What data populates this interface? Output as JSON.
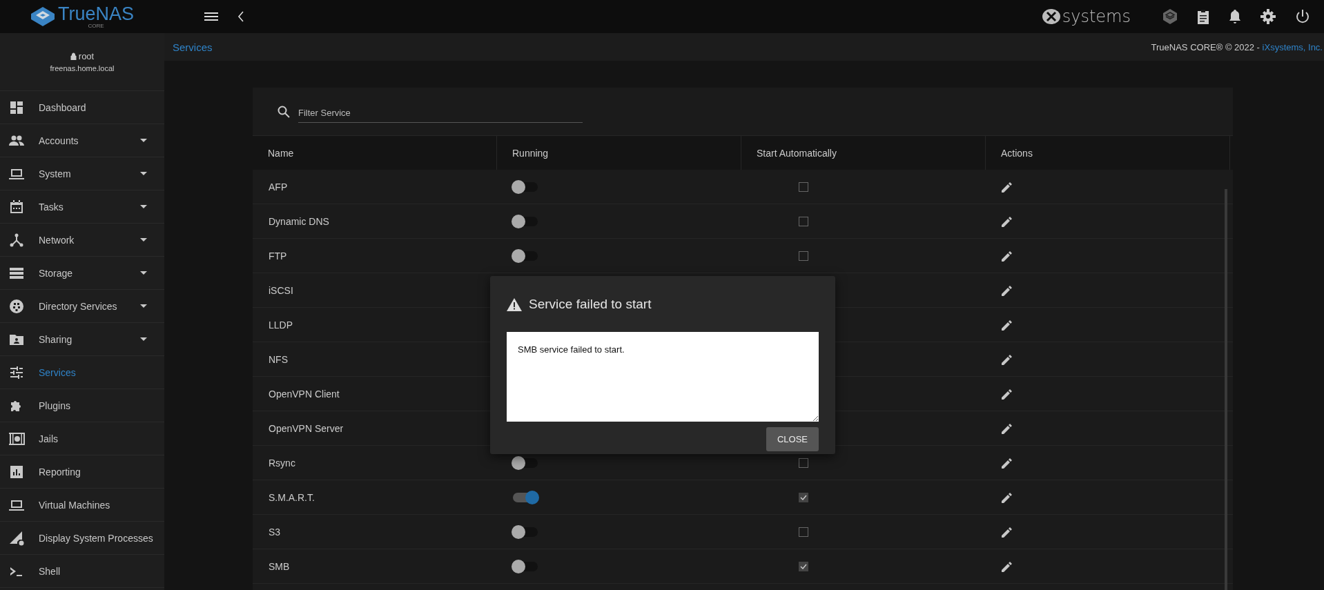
{
  "header": {
    "logo_text": "TrueNAS",
    "logo_subtext": "CORE",
    "vendor_logo_text": "systems"
  },
  "user": {
    "name": "root",
    "host": "freenas.home.local"
  },
  "sidebar": {
    "items": [
      {
        "label": "Dashboard",
        "expandable": false,
        "selected": false
      },
      {
        "label": "Accounts",
        "expandable": true,
        "selected": false
      },
      {
        "label": "System",
        "expandable": true,
        "selected": false
      },
      {
        "label": "Tasks",
        "expandable": true,
        "selected": false
      },
      {
        "label": "Network",
        "expandable": true,
        "selected": false
      },
      {
        "label": "Storage",
        "expandable": true,
        "selected": false
      },
      {
        "label": "Directory Services",
        "expandable": true,
        "selected": false
      },
      {
        "label": "Sharing",
        "expandable": true,
        "selected": false
      },
      {
        "label": "Services",
        "expandable": false,
        "selected": true
      },
      {
        "label": "Plugins",
        "expandable": false,
        "selected": false
      },
      {
        "label": "Jails",
        "expandable": false,
        "selected": false
      },
      {
        "label": "Reporting",
        "expandable": false,
        "selected": false
      },
      {
        "label": "Virtual Machines",
        "expandable": false,
        "selected": false
      },
      {
        "label": "Display System Processes",
        "expandable": false,
        "selected": false
      },
      {
        "label": "Shell",
        "expandable": false,
        "selected": false
      }
    ]
  },
  "breadcrumb": "Services",
  "copyright": {
    "text": "TrueNAS CORE® © 2022 - ",
    "link": "iXsystems, Inc."
  },
  "search": {
    "placeholder": "Filter Service"
  },
  "table": {
    "columns": [
      "Name",
      "Running",
      "Start Automatically",
      "Actions"
    ],
    "rows": [
      {
        "name": "AFP",
        "running": false,
        "start_automatically": false
      },
      {
        "name": "Dynamic DNS",
        "running": false,
        "start_automatically": false
      },
      {
        "name": "FTP",
        "running": false,
        "start_automatically": false
      },
      {
        "name": "iSCSI"
      },
      {
        "name": "LLDP"
      },
      {
        "name": "NFS"
      },
      {
        "name": "OpenVPN Client"
      },
      {
        "name": "OpenVPN Server"
      },
      {
        "name": "Rsync",
        "running": false,
        "start_automatically": false
      },
      {
        "name": "S.M.A.R.T.",
        "running": true,
        "start_automatically": true
      },
      {
        "name": "S3",
        "running": false,
        "start_automatically": false
      },
      {
        "name": "SMB",
        "running": false,
        "start_automatically": true
      }
    ]
  },
  "dialog": {
    "title": "Service failed to start",
    "message": "SMB service failed to start.",
    "button": "CLOSE"
  }
}
